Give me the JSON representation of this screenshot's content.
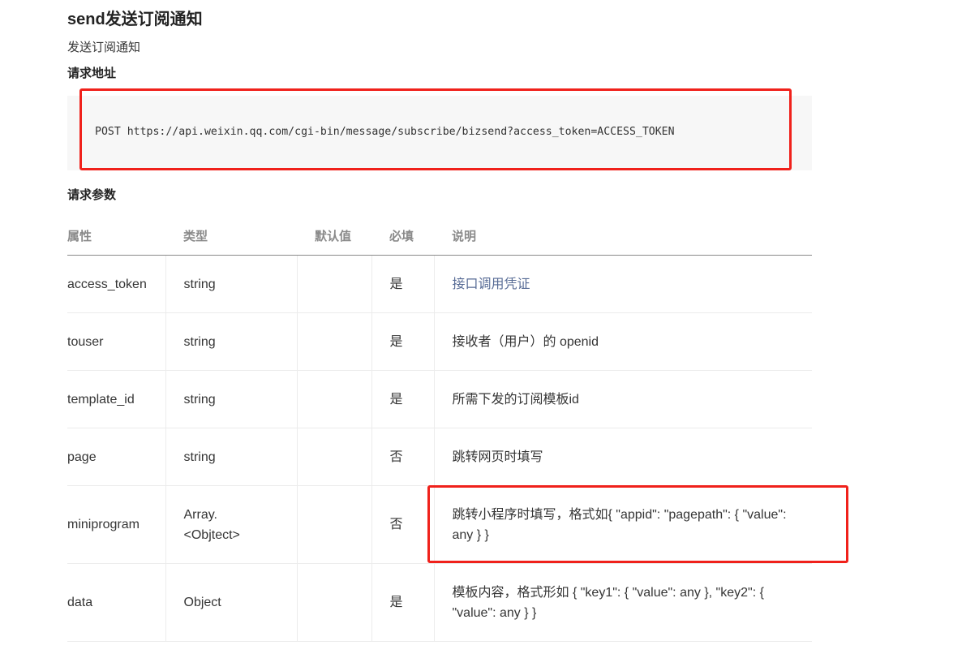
{
  "page": {
    "title": "send发送订阅通知",
    "description": "发送订阅通知"
  },
  "request_url": {
    "heading": "请求地址",
    "code": "POST https://api.weixin.qq.com/cgi-bin/message/subscribe/bizsend?access_token=ACCESS_TOKEN"
  },
  "request_params": {
    "heading": "请求参数",
    "columns": [
      "属性",
      "类型",
      "默认值",
      "必填",
      "说明"
    ],
    "rows": [
      {
        "attr": "access_token",
        "type": "string",
        "default": "",
        "required": "是",
        "note": "接口调用凭证"
      },
      {
        "attr": "touser",
        "type": "string",
        "default": "",
        "required": "是",
        "note": "接收者（用户）的 openid"
      },
      {
        "attr": "template_id",
        "type": "string",
        "default": "",
        "required": "是",
        "note": "所需下发的订阅模板id"
      },
      {
        "attr": "page",
        "type": "string",
        "default": "",
        "required": "否",
        "note": "跳转网页时填写"
      },
      {
        "attr": "miniprogram",
        "type": "Array.<Objtect>",
        "default": "",
        "required": "否",
        "note": "跳转小程序时填写，格式如{ \"appid\": \"pagepath\": { \"value\": any } }"
      },
      {
        "attr": "data",
        "type": "Object",
        "default": "",
        "required": "是",
        "note": "模板内容，格式形如 { \"key1\": { \"value\": any }, \"key2\": { \"value\": any } }"
      }
    ]
  },
  "colors": {
    "annotation_border": "#f0211b",
    "link": "#576b95",
    "code_background": "#f7f7f7"
  }
}
